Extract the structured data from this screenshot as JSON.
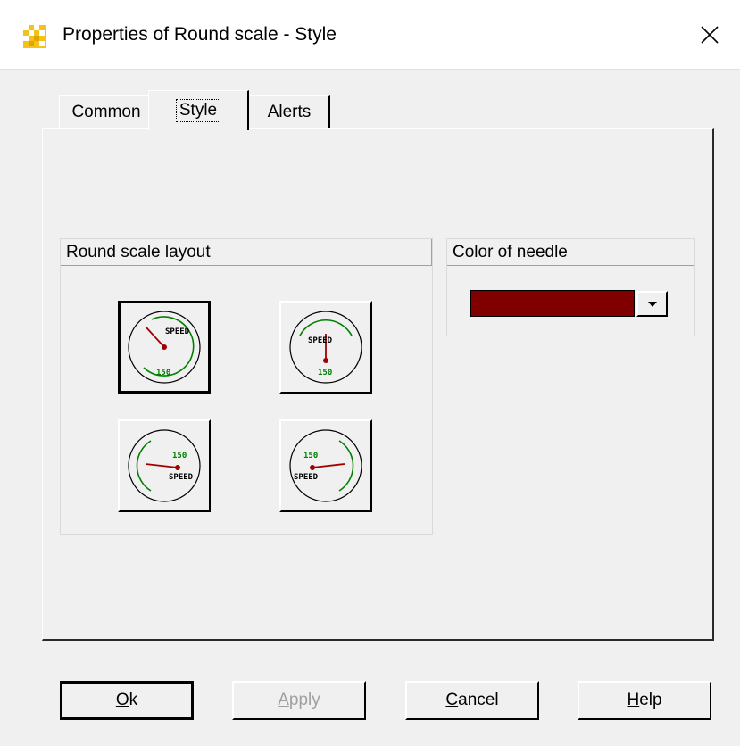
{
  "window": {
    "title": "Properties of Round scale  - Style",
    "icon": "app-grid-icon",
    "close_icon": "close-icon"
  },
  "tabs": [
    {
      "label": "Common",
      "selected": false
    },
    {
      "label": "Style",
      "selected": true
    },
    {
      "label": "Alerts",
      "selected": false
    }
  ],
  "layout_group": {
    "title": "Round scale layout",
    "options": [
      {
        "speed_label": "SPEED",
        "value_label": "150",
        "orientation": "top-left",
        "selected": true
      },
      {
        "speed_label": "SPEED",
        "value_label": "150",
        "orientation": "top",
        "selected": false
      },
      {
        "speed_label": "SPEED",
        "value_label": "150",
        "orientation": "right",
        "selected": false
      },
      {
        "speed_label": "SPEED",
        "value_label": "150",
        "orientation": "left",
        "selected": false
      }
    ]
  },
  "needle_group": {
    "title": "Color of needle",
    "color": "#800000",
    "dropdown_icon": "chevron-down-icon"
  },
  "buttons": {
    "ok": {
      "pre": "",
      "mnemonic": "O",
      "post": "k"
    },
    "apply": {
      "pre": "",
      "mnemonic": "A",
      "post": "pply"
    },
    "cancel": {
      "pre": "",
      "mnemonic": "C",
      "post": "ancel"
    },
    "help": {
      "pre": "",
      "mnemonic": "H",
      "post": "elp"
    }
  },
  "colors": {
    "gauge_arc": "#008000",
    "gauge_needle": "#a00000",
    "gauge_text_green": "#008000"
  }
}
